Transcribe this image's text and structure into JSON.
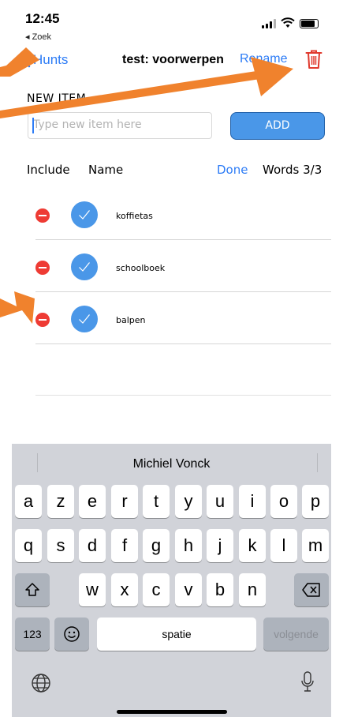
{
  "status_bar": {
    "time": "12:45",
    "back_app": "◂ Zoek"
  },
  "nav": {
    "back_label": "Hunts",
    "title": "test: voorwerpen",
    "rename_label": "Rename"
  },
  "new_item": {
    "label": "NEW ITEM",
    "placeholder": "Type new item here",
    "add_label": "ADD"
  },
  "list_header": {
    "include": "Include",
    "name": "Name",
    "done": "Done",
    "words": "Words 3/3"
  },
  "items": [
    {
      "name": "koffietas"
    },
    {
      "name": "schoolboek"
    },
    {
      "name": "balpen"
    }
  ],
  "keyboard": {
    "suggestion": "Michiel Vonck",
    "row1": [
      "a",
      "z",
      "e",
      "r",
      "t",
      "y",
      "u",
      "i",
      "o",
      "p"
    ],
    "row2": [
      "q",
      "s",
      "d",
      "f",
      "g",
      "h",
      "j",
      "k",
      "l",
      "m"
    ],
    "row3": [
      "w",
      "x",
      "c",
      "v",
      "b",
      "n"
    ],
    "numbers_label": "123",
    "space_label": "spatie",
    "return_label": "volgende"
  },
  "colors": {
    "accent": "#2d7cf6",
    "delete": "#ee3b34",
    "check": "#4a97e8",
    "annotation_arrow": "#f0822d"
  }
}
